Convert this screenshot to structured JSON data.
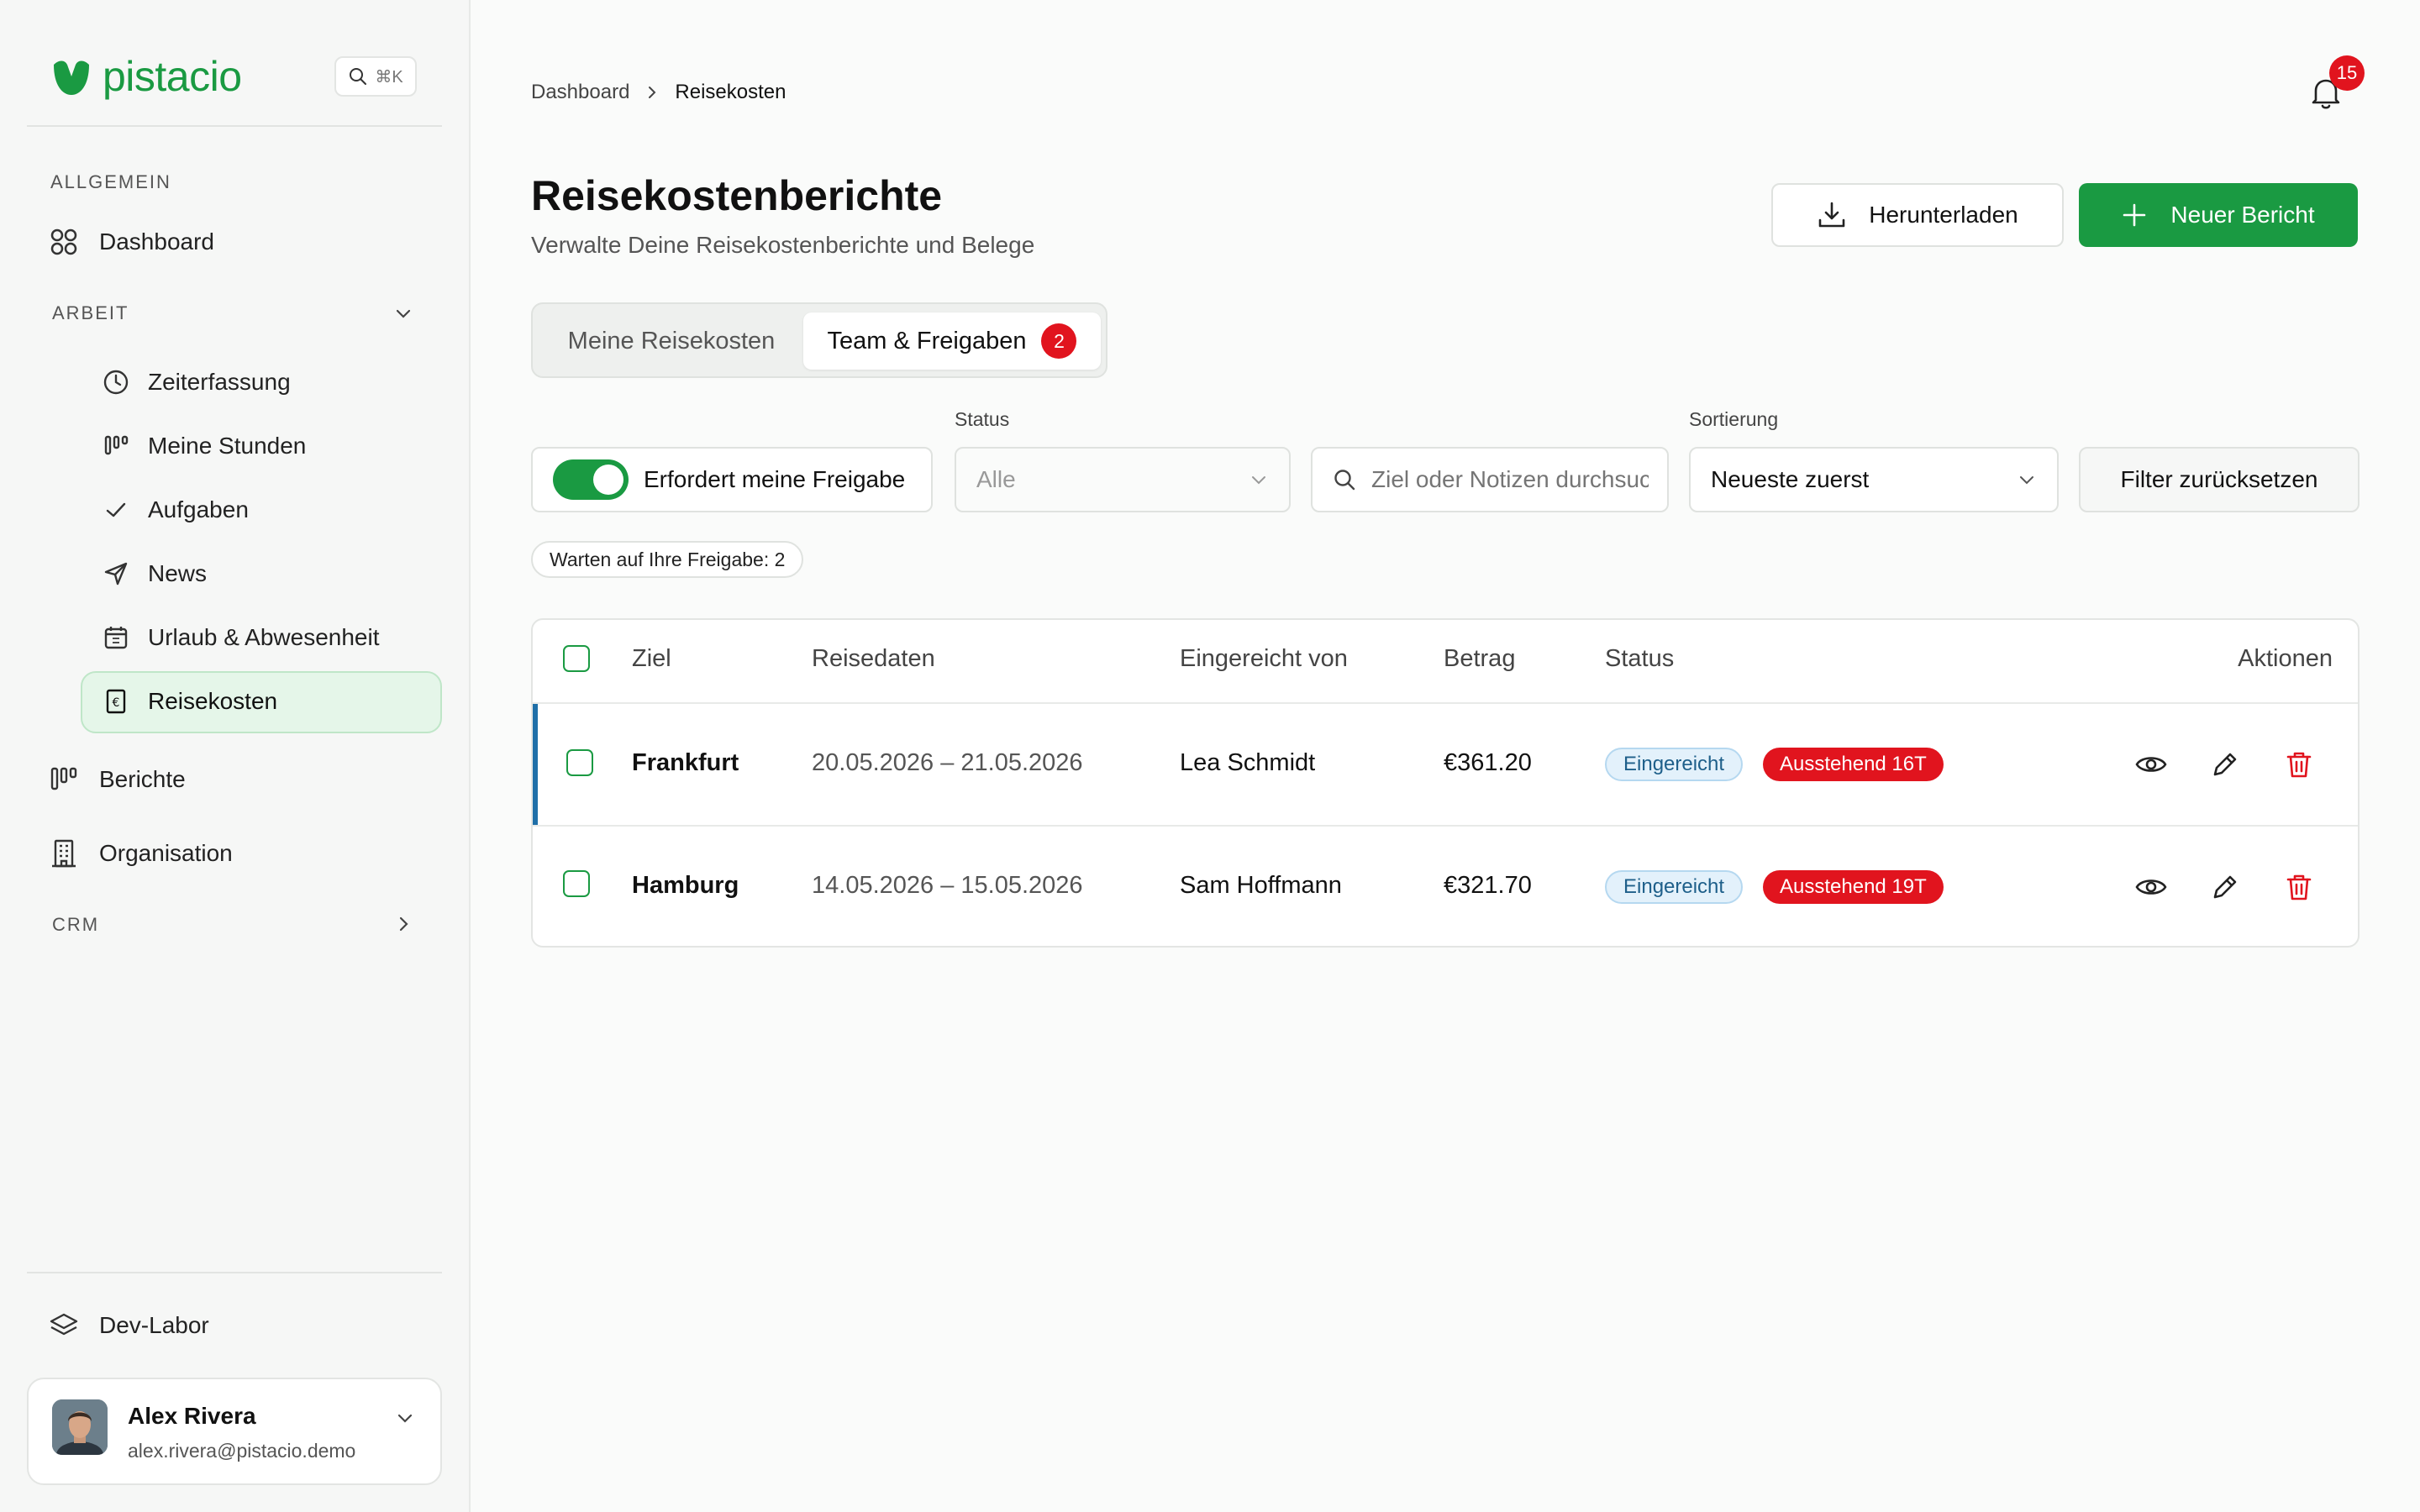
{
  "brand": {
    "name": "pistacio",
    "shortcut": "⌘K",
    "color": "#1a9a42"
  },
  "sidebar": {
    "section_general": "ALLGEMEIN",
    "dashboard": "Dashboard",
    "section_work": "ARBEIT",
    "work_items": [
      {
        "label": "Zeiterfassung",
        "icon": "clock-icon"
      },
      {
        "label": "Meine Stunden",
        "icon": "bars-icon"
      },
      {
        "label": "Aufgaben",
        "icon": "check-icon"
      },
      {
        "label": "News",
        "icon": "send-icon"
      },
      {
        "label": "Urlaub & Abwesenheit",
        "icon": "calendar-icon"
      },
      {
        "label": "Reisekosten",
        "icon": "receipt-icon",
        "active": true
      }
    ],
    "reports": "Berichte",
    "organisation": "Organisation",
    "section_crm": "CRM",
    "dev_lab": "Dev-Labor",
    "user": {
      "name": "Alex Rivera",
      "email": "alex.rivera@pistacio.demo"
    }
  },
  "header": {
    "breadcrumb": [
      "Dashboard",
      "Reisekosten"
    ],
    "notifications": "15"
  },
  "page": {
    "title": "Reisekostenberichte",
    "subtitle": "Verwalte Deine Reisekostenberichte und Belege",
    "download_label": "Herunterladen",
    "new_report_label": "Neuer Bericht"
  },
  "tabs": {
    "mine": "Meine Reisekosten",
    "team": "Team & Freigaben",
    "team_count": "2"
  },
  "filters": {
    "toggle_label": "Erfordert meine Freigabe",
    "toggle_on": true,
    "status_label": "Status",
    "status_value": "Alle",
    "search_placeholder": "Ziel oder Notizen durchsuchen",
    "sort_label": "Sortierung",
    "sort_value": "Neueste zuerst",
    "reset_label": "Filter zurücksetzen",
    "waiting_chip": "Warten auf Ihre Freigabe: 2"
  },
  "table": {
    "columns": [
      "Ziel",
      "Reisedaten",
      "Eingereicht von",
      "Betrag",
      "Status",
      "Aktionen"
    ],
    "rows": [
      {
        "destination": "Frankfurt",
        "dates": "20.05.2026 – 21.05.2026",
        "submitted_by": "Lea Schmidt",
        "amount": "€361.20",
        "status": "Eingereicht",
        "pending": "Ausstehend 16T"
      },
      {
        "destination": "Hamburg",
        "dates": "14.05.2026 – 15.05.2026",
        "submitted_by": "Sam Hoffmann",
        "amount": "€321.70",
        "status": "Eingereicht",
        "pending": "Ausstehend 19T"
      }
    ]
  }
}
